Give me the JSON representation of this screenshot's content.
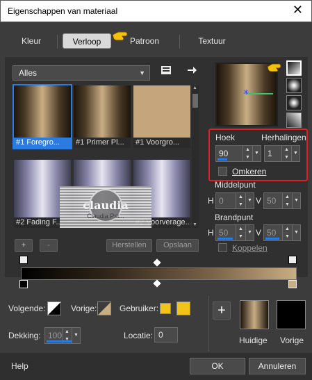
{
  "window": {
    "title": "Eigenschappen van materiaal",
    "close_glyph": "✕"
  },
  "tabs": [
    {
      "label": "Kleur"
    },
    {
      "label": "Verloop",
      "active": true
    },
    {
      "label": "Patroon"
    },
    {
      "label": "Textuur"
    }
  ],
  "library": {
    "category": "Alles"
  },
  "thumbs": [
    {
      "label": "#1 Foregro..."
    },
    {
      "label": "#1 Primer Pl..."
    },
    {
      "label": "#1 Voorgro..."
    },
    {
      "label": "#2 Fading F..."
    },
    {
      "label": ""
    },
    {
      "label": "#2 Voorverage..."
    }
  ],
  "watermark": {
    "text": "claudia",
    "sub": "Claudia Pst..."
  },
  "list_buttons": {
    "add": "+",
    "remove": "-",
    "reset": "Herstellen",
    "save": "Opslaan"
  },
  "params": {
    "angle_label": "Hoek",
    "angle_value": "90",
    "repeats_label": "Herhalingen",
    "repeats_value": "1",
    "invert_label": "Omkeren",
    "center_label": "Middelpunt",
    "h_label": "H",
    "v_label": "V",
    "center_h": "0",
    "center_v": "50",
    "focal_label": "Brandpunt",
    "focal_h": "50",
    "focal_v": "50",
    "link_label": "Koppelen"
  },
  "colors": {
    "accent": "#2c7be0",
    "highlight_box": "#e02020",
    "user_color": "#f2c318",
    "gradient_mid": "#c9ad83"
  },
  "bottom": {
    "next_label": "Volgende:",
    "prev_label": "Vorige:",
    "user_label": "Gebruiker:",
    "opacity_label": "Dekking:",
    "opacity_value": "100",
    "location_label": "Locatie:",
    "location_value": "0",
    "current_label": "Huidige",
    "previous_label": "Vorige"
  },
  "footer": {
    "help": "Help",
    "ok": "OK",
    "cancel": "Annuleren"
  }
}
